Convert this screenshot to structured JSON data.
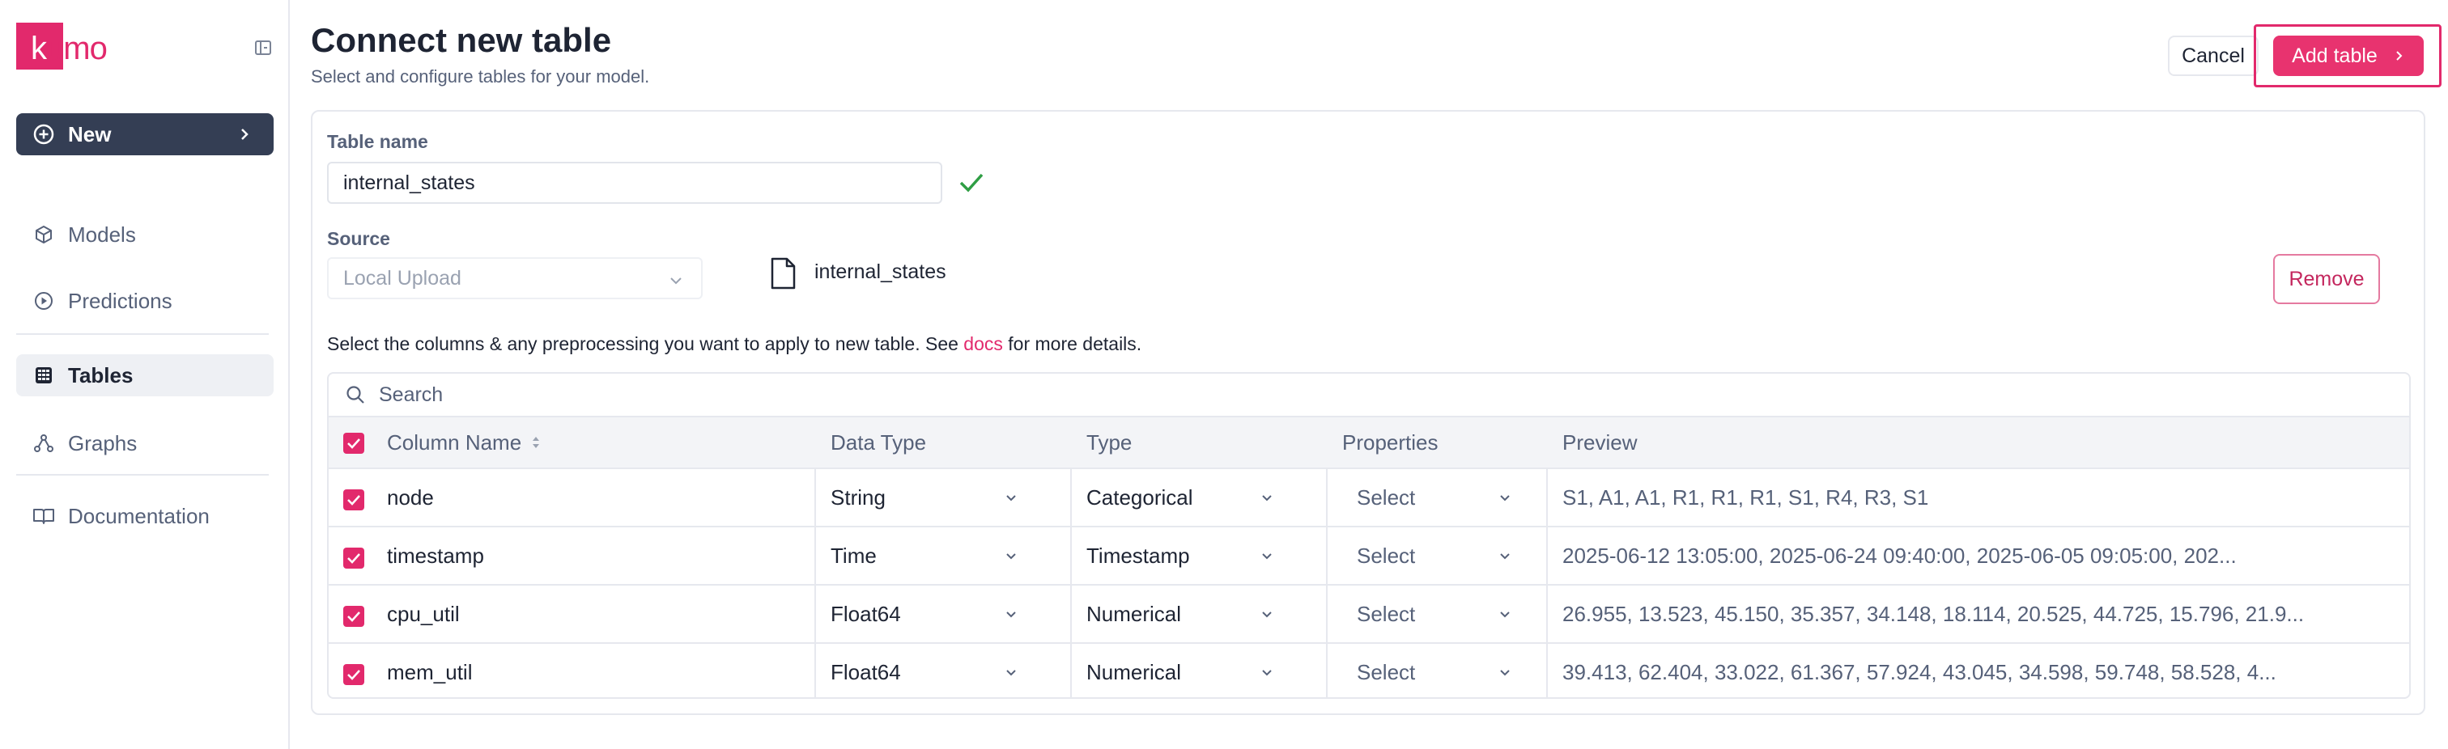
{
  "app": {
    "logo_text": "kumo",
    "logo_color": "#e2296c"
  },
  "sidebar": {
    "new_label": "New",
    "items": [
      {
        "label": "Models",
        "icon": "cube-icon"
      },
      {
        "label": "Predictions",
        "icon": "play-circle-icon"
      },
      {
        "label": "Tables",
        "icon": "table-grid-icon",
        "active": true
      },
      {
        "label": "Graphs",
        "icon": "graph-nodes-icon"
      },
      {
        "label": "Documentation",
        "icon": "book-icon"
      }
    ]
  },
  "header": {
    "title": "Connect new table",
    "subtitle": "Select and configure tables for your model.",
    "cancel_label": "Cancel",
    "add_label": "Add table"
  },
  "form": {
    "table_name_label": "Table name",
    "table_name_value": "internal_states",
    "source_label": "Source",
    "source_value": "Local Upload",
    "file_name": "internal_states",
    "remove_label": "Remove",
    "help_prefix": "Select the columns & any preprocessing you want to apply to new table. See",
    "help_link": "docs",
    "help_suffix": "for more details."
  },
  "table": {
    "search_placeholder": "Search",
    "headers": {
      "column_name": "Column Name",
      "data_type": "Data Type",
      "type": "Type",
      "properties": "Properties",
      "preview": "Preview"
    },
    "rows": [
      {
        "name": "node",
        "data_type": "String",
        "type": "Categorical",
        "properties": "Select",
        "preview": "S1, A1, A1, R1, R1, R1, S1, R4, R3, S1",
        "checked": true
      },
      {
        "name": "timestamp",
        "data_type": "Time",
        "type": "Timestamp",
        "properties": "Select",
        "preview": "2025-06-12 13:05:00, 2025-06-24 09:40:00, 2025-06-05 09:05:00, 202...",
        "checked": true
      },
      {
        "name": "cpu_util",
        "data_type": "Float64",
        "type": "Numerical",
        "properties": "Select",
        "preview": "26.955, 13.523, 45.150, 35.357, 34.148, 18.114, 20.525, 44.725, 15.796, 21.9...",
        "checked": true
      },
      {
        "name": "mem_util",
        "data_type": "Float64",
        "type": "Numerical",
        "properties": "Select",
        "preview": "39.413, 62.404, 33.022, 61.367, 57.924, 43.045, 34.598, 59.748, 58.528, 4...",
        "checked": true
      }
    ]
  }
}
